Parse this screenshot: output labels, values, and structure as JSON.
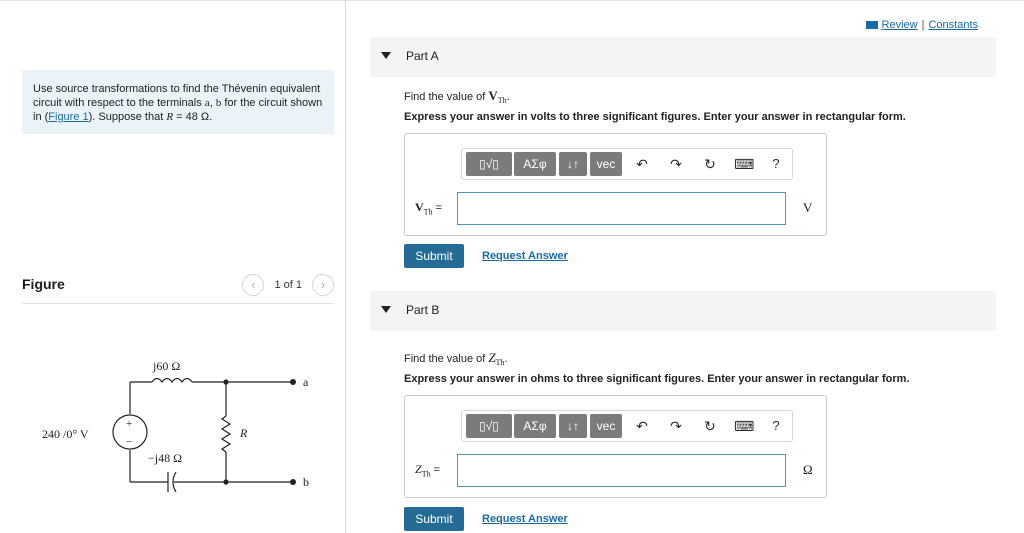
{
  "header": {
    "review_label": "Review",
    "separator": "|",
    "constants_label": "Constants"
  },
  "problem": {
    "text_1": "Use source transformations to find the Thévenin equivalent circuit with respect to the terminals ",
    "term_a": "a",
    "text_2": ", ",
    "term_b": "b",
    "text_3": " for the circuit shown in (",
    "figure_link": "Figure 1",
    "text_4": "). Suppose that ",
    "var_r": "R",
    "text_5": " = 48 Ω."
  },
  "figure": {
    "title": "Figure",
    "pager_label": "1 of 1",
    "prev_icon": "chevron-left-icon",
    "next_icon": "chevron-right-icon",
    "prev_glyph": "‹",
    "next_glyph": "›",
    "circuit": {
      "source_label": "240 /0° V",
      "inductor_label": "j60 Ω",
      "capacitor_label": "−j48 Ω",
      "resistor_label": "R",
      "terminal_a": "a",
      "terminal_b": "b",
      "plus": "+",
      "minus": "−"
    }
  },
  "parts": [
    {
      "title": "Part A",
      "question_prefix": "Find the value of ",
      "question_var": "V",
      "question_sub": "Th",
      "question_suffix": ".",
      "instruction": "Express your answer in volts to three significant figures. Enter your answer in rectangular form.",
      "answer_var": "V",
      "answer_sub": "Th",
      "answer_eq": " =",
      "unit": "V",
      "answer_value": "",
      "submit_label": "Submit",
      "request_label": "Request Answer"
    },
    {
      "title": "Part B",
      "question_prefix": "Find the value of ",
      "question_var": "Z",
      "question_sub": "Th",
      "question_suffix": ".",
      "instruction": "Express your answer in ohms to three significant figures. Enter your answer in rectangular form.",
      "answer_var": "Z",
      "answer_sub": "Th",
      "answer_eq": " =",
      "unit": "Ω",
      "answer_value": "",
      "submit_label": "Submit",
      "request_label": "Request Answer"
    }
  ],
  "toolbar": {
    "templates_label": "▯√▯",
    "symbols_label": "ΑΣφ",
    "sort_label": "↓↑",
    "vec_label": "vec",
    "undo_glyph": "↶",
    "redo_glyph": "↷",
    "reset_glyph": "↻",
    "keyboard_glyph": "⌨",
    "help_glyph": "?"
  },
  "colors": {
    "accent": "#246c95",
    "link": "#1a6aa3",
    "panel": "#eaf3f7",
    "tool_button": "#7b7b7b"
  }
}
